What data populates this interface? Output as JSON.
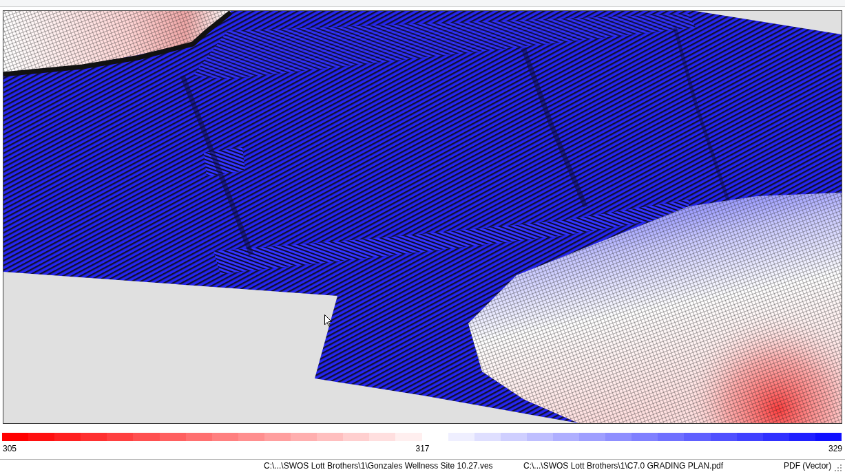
{
  "legend": {
    "swatches": [
      {
        "color": "#ff0000"
      },
      {
        "color": "#ff1010"
      },
      {
        "color": "#ff2020"
      },
      {
        "color": "#ff3030"
      },
      {
        "color": "#ff4040"
      },
      {
        "color": "#ff5050"
      },
      {
        "color": "#ff6060"
      },
      {
        "color": "#ff7070"
      },
      {
        "color": "#ff8080"
      },
      {
        "color": "#ff8f8f"
      },
      {
        "color": "#ff9f9f"
      },
      {
        "color": "#ffafaf"
      },
      {
        "color": "#ffbfbf"
      },
      {
        "color": "#ffcfcf"
      },
      {
        "color": "#ffdfdf"
      },
      {
        "color": "#ffefef"
      },
      {
        "color": "#ffffff"
      },
      {
        "color": "#efefff"
      },
      {
        "color": "#dfdfff"
      },
      {
        "color": "#cfcfff"
      },
      {
        "color": "#bfbfff"
      },
      {
        "color": "#afafff"
      },
      {
        "color": "#9f9fff"
      },
      {
        "color": "#8f8fff"
      },
      {
        "color": "#8080ff"
      },
      {
        "color": "#7070ff"
      },
      {
        "color": "#6060ff"
      },
      {
        "color": "#5050ff"
      },
      {
        "color": "#4040ff"
      },
      {
        "color": "#3030ff"
      },
      {
        "color": "#2020ff"
      },
      {
        "color": "#1010ff"
      }
    ],
    "labels": [
      "305",
      "317",
      "329"
    ]
  },
  "status_bar": {
    "panes": [
      "C:\\...\\SWOS Lott Brothers\\1\\Gonzales Wellness Site 10.27.ves",
      "C:\\...\\SWOS Lott Brothers\\1\\C7.0 GRADING PLAN.pdf",
      "PDF (Vector)"
    ]
  }
}
